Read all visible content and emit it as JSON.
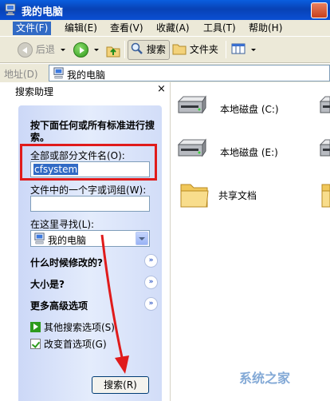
{
  "window": {
    "title": "我的电脑"
  },
  "menubar": {
    "items": [
      "文件(F)",
      "编辑(E)",
      "查看(V)",
      "收藏(A)",
      "工具(T)",
      "帮助(H)"
    ]
  },
  "toolbar": {
    "back_label": "后退",
    "search_label": "搜索",
    "folders_label": "文件夹"
  },
  "address": {
    "label": "地址(D)",
    "value": "我的电脑"
  },
  "search_pane": {
    "title": "搜索助理",
    "close_glyph": "×",
    "intro": "按下面任何或所有标准进行搜索。",
    "filename_label": "全部或部分文件名(O):",
    "filename_value": "cfsystem",
    "phrase_label": "文件中的一个字或词组(W):",
    "phrase_value": "",
    "lookin_label": "在这里寻找(L):",
    "lookin_value": "我的电脑",
    "section_modified": "什么时候修改的?",
    "section_size": "大小是?",
    "section_advanced": "更多高级选项",
    "expand_glyph": "»",
    "link_other": "其他搜索选项(S)",
    "link_prefs": "改变首选项(G)",
    "search_button": "搜索(R)"
  },
  "items": [
    {
      "label": "本地磁盘 (C:)",
      "type": "drive"
    },
    {
      "label": "本地磁盘 (E:)",
      "type": "drive"
    },
    {
      "label": "共享文档",
      "type": "folder"
    }
  ],
  "watermark": "系统之家",
  "colors": {
    "titlebar": "#0842b5",
    "menu_active": "#316ac5",
    "highlight": "#e01b1b",
    "pane_bg": "#d2ddf8"
  }
}
